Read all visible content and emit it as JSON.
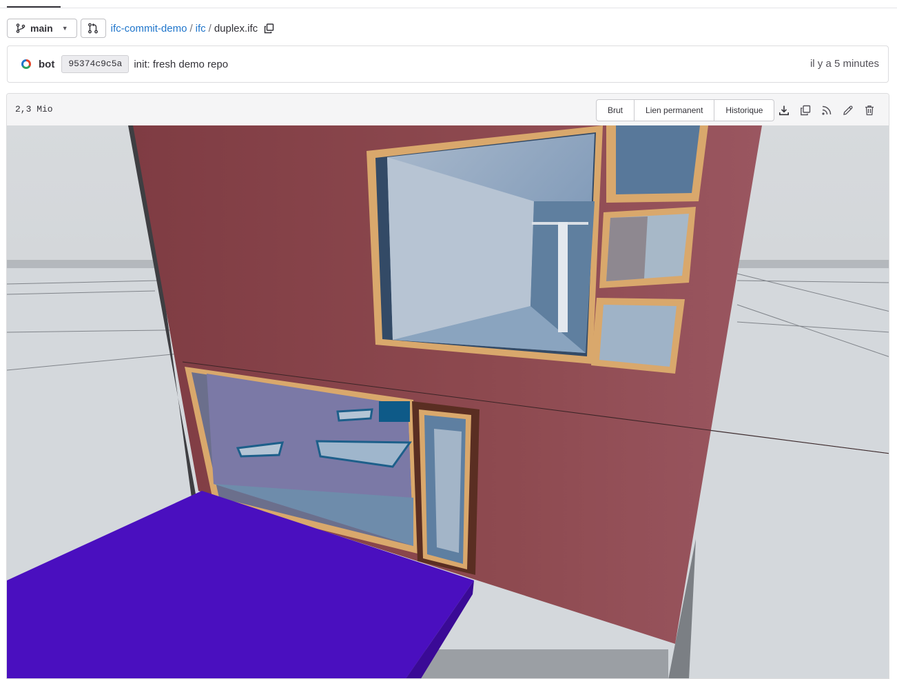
{
  "branch": {
    "name": "main"
  },
  "breadcrumb": {
    "project": "ifc-commit-demo",
    "folder": "ifc",
    "file": "duplex.ifc",
    "separator": "/"
  },
  "commit": {
    "author": "bot",
    "sha": "95374c9c5a",
    "message": "init: fresh demo repo",
    "time": "il y a 5 minutes"
  },
  "file": {
    "size": "2,3 Mio"
  },
  "actions": {
    "raw": "Brut",
    "permalink": "Lien permanent",
    "history": "Historique"
  },
  "icons": [
    "branch-icon",
    "chevron-down-icon",
    "merge-request-icon",
    "copy-path-icon",
    "download-icon",
    "copy-contents-icon",
    "rss-icon",
    "pencil-icon",
    "trash-icon"
  ],
  "colors": {
    "link": "#1f75cb",
    "wall": "#8c4a4e",
    "window_frame": "#d9a86c",
    "slab": "#4a0fbf"
  }
}
